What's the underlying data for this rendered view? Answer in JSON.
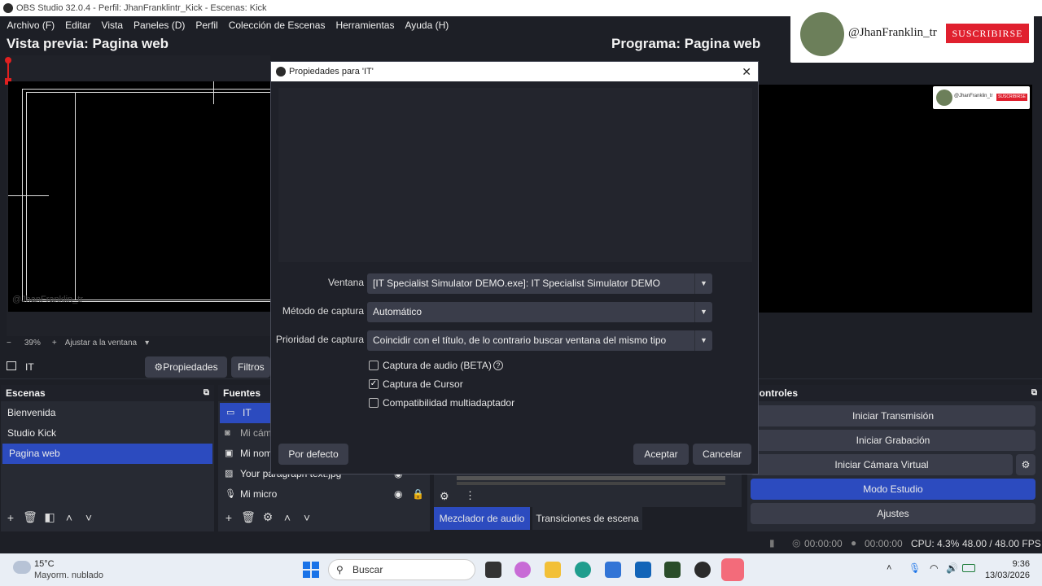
{
  "window": {
    "title": "OBS Studio 32.0.4 - Perfil: JhanFranklintr_Kick - Escenas: Kick",
    "close_icon": "close-icon"
  },
  "menu": [
    "Archivo (F)",
    "Editar",
    "Vista",
    "Paneles (D)",
    "Perfil",
    "Colección de Escenas",
    "Herramientas",
    "Ayuda (H)"
  ],
  "preview": {
    "title": "Vista previa: Pagina web",
    "watermark": "@JhanFranklin_tr"
  },
  "program": {
    "title": "Programa: Pagina web"
  },
  "overlay": {
    "handle": "@JhanFranklin_tr",
    "subscribe": "SUSCRIBIRSE",
    "small_handle": "@JhanFranklin_tr",
    "small_subscribe": "SUSCRIBIRSE"
  },
  "zoom": {
    "minus": "−",
    "value": "39%",
    "plus": "+",
    "fit": "Ajustar a la ventana",
    "chevron": "▾"
  },
  "source_bar": {
    "name": "IT",
    "properties": "Propiedades",
    "filters": "Filtros"
  },
  "scenes": {
    "title": "Escenas",
    "items": [
      "Bienvenida",
      "Studio Kick",
      "Pagina web"
    ],
    "selected": "Pagina web"
  },
  "sources": {
    "title": "Fuentes",
    "items": [
      {
        "icon": "window-capture-icon",
        "label": "IT"
      },
      {
        "icon": "camera-icon",
        "label": "Mi cámara"
      },
      {
        "icon": "text-icon",
        "label": "Mi nombre"
      },
      {
        "icon": "image-icon",
        "label": "Your paragraph text.jpg"
      },
      {
        "icon": "microphone-icon",
        "label": "Mi micro"
      }
    ]
  },
  "controls": {
    "title": "Controles",
    "start_stream": "Iniciar Transmisión",
    "start_record": "Iniciar Grabación",
    "start_vcam": "Iniciar Cámara Virtual",
    "studio_mode": "Modo Estudio",
    "settings": "Ajustes"
  },
  "dock_tabs": {
    "mixer": "Mezclador de audio",
    "transitions": "Transiciones de escena"
  },
  "status": {
    "stream_time": "00:00:00",
    "record_time": "00:00:00",
    "cpu": "CPU: 4.3%",
    "fps": "48.00 / 48.00 FPS"
  },
  "dialog": {
    "title": "Propiedades para 'IT'",
    "window_label": "Ventana",
    "window_value": "[IT Specialist Simulator DEMO.exe]: IT Specialist Simulator DEMO",
    "method_label": "Método de captura",
    "method_value": "Automático",
    "priority_label": "Prioridad de captura",
    "priority_value": "Coincidir con el título, de lo contrario buscar ventana del mismo tipo",
    "audio_capture": "Captura de audio (BETA)",
    "audio_checked": false,
    "cursor_capture": "Captura de Cursor",
    "cursor_checked": true,
    "multiadapter": "Compatibilidad multiadaptador",
    "multiadapter_checked": false,
    "defaults": "Por defecto",
    "ok": "Aceptar",
    "cancel": "Cancelar"
  },
  "taskbar": {
    "temp": "15°C",
    "weather": "Mayorm. nublado",
    "search": "Buscar",
    "time": "9:36",
    "date": "13/03/2026"
  },
  "colors": {
    "accent": "#2c4bbf",
    "bg": "#1d1f26",
    "panel": "#272a33",
    "button": "#3a3d4a",
    "subscribe": "#e0202e"
  }
}
